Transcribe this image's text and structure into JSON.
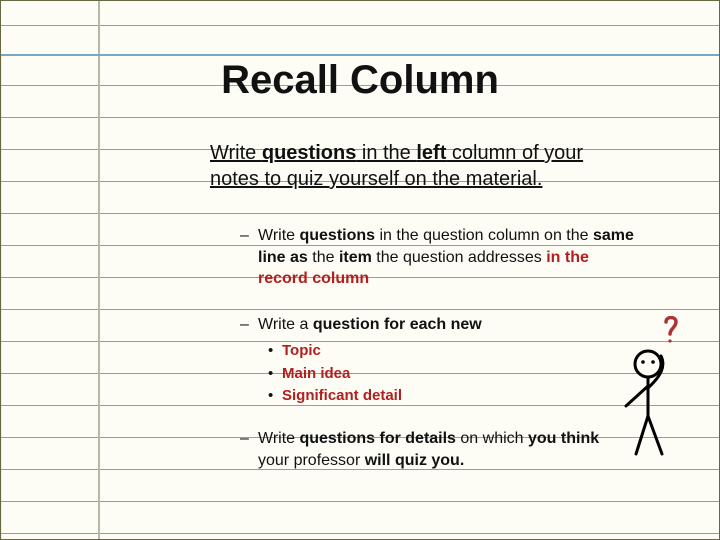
{
  "title": "Recall Column",
  "intro": {
    "pre": "Write ",
    "q": "questions",
    "mid": " in the ",
    "left": "left",
    "post": " column of your notes to quiz yourself on the material."
  },
  "b1": {
    "pre": "Write ",
    "q": "questions",
    "mid1": " in the question column on the ",
    "same": "same line as",
    "mid2": " the ",
    "item": "item",
    "mid3": " the question addresses ",
    "in_red": "in the record column"
  },
  "b2": {
    "pre": "Write a ",
    "bold": "question for each new"
  },
  "sub": {
    "a": "Topic",
    "b": "Main idea",
    "c": "Significant detail"
  },
  "b3": {
    "pre": "Write ",
    "qfd": "questions for details",
    "mid": " on which ",
    "yt": "you think",
    "post": " your professor ",
    "quiz": "will quiz you."
  }
}
